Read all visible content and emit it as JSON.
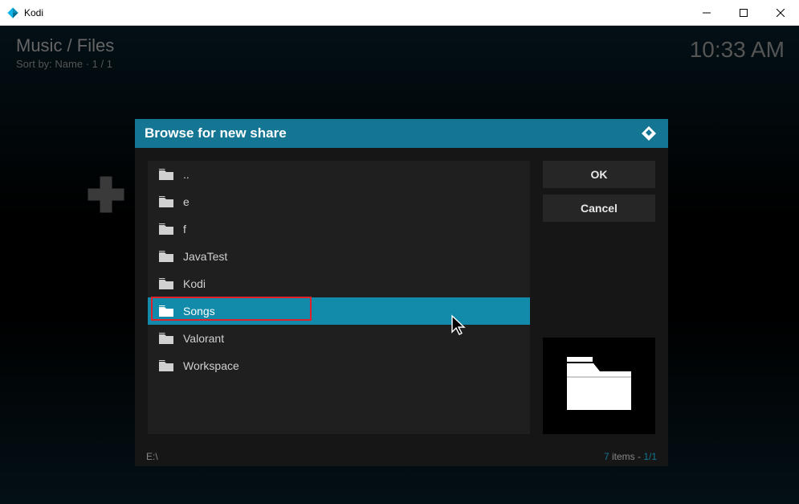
{
  "window": {
    "title": "Kodi"
  },
  "header": {
    "breadcrumb": "Music / Files",
    "sort": "Sort by: Name  ·  1 / 1",
    "clock": "10:33 AM"
  },
  "dialog": {
    "title": "Browse for new share",
    "items": [
      {
        "name": "..",
        "icon": "folder",
        "selected": false
      },
      {
        "name": "e",
        "icon": "folder",
        "selected": false
      },
      {
        "name": "f",
        "icon": "folder",
        "selected": false
      },
      {
        "name": "JavaTest",
        "icon": "folder",
        "selected": false
      },
      {
        "name": "Kodi",
        "icon": "folder",
        "selected": false
      },
      {
        "name": "Songs",
        "icon": "folder",
        "selected": true
      },
      {
        "name": "Valorant",
        "icon": "folder",
        "selected": false
      },
      {
        "name": "Workspace",
        "icon": "folder",
        "selected": false
      }
    ],
    "buttons": {
      "ok": "OK",
      "cancel": "Cancel"
    },
    "footer": {
      "path": "E:\\",
      "count_num": "7",
      "count_label": " items - ",
      "page": "1/1"
    }
  }
}
